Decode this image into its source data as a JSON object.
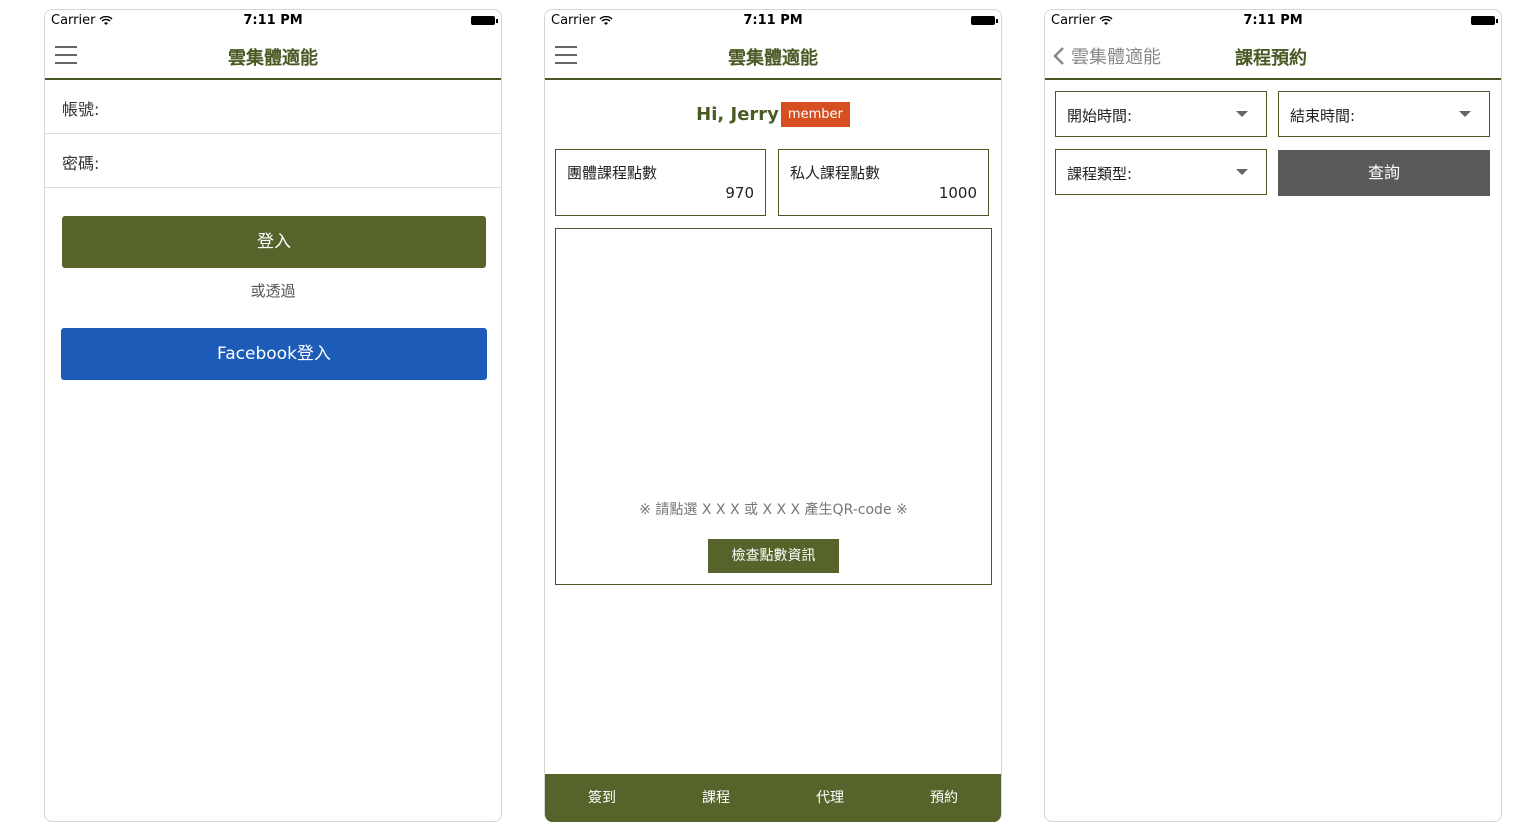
{
  "status_bar": {
    "carrier": "Carrier",
    "time": "7:11 PM"
  },
  "login": {
    "title": "雲集體適能",
    "account_label": "帳號:",
    "password_label": "密碼:",
    "login_button": "登入",
    "or_text": "或透過",
    "facebook_button": "Facebook登入"
  },
  "home": {
    "title": "雲集體適能",
    "greeting": "Hi, Jerry",
    "badge": "member",
    "group_points_label": "團體課程點數",
    "group_points_value": "970",
    "private_points_label": "私人課程點數",
    "private_points_value": "1000",
    "qr_hint": "※ 請點選 X X X 或 X X X 產生QR-code ※",
    "check_button": "檢查點數資訊",
    "tabs": [
      "簽到",
      "課程",
      "代理",
      "預約"
    ]
  },
  "booking": {
    "back_label": "雲集體適能",
    "title": "課程預約",
    "start_time_label": "開始時間:",
    "end_time_label": "結束時間:",
    "course_type_label": "課程類型:",
    "query_button": "查詢"
  },
  "colors": {
    "olive": "#56642b",
    "facebook": "#1c5bb8",
    "badge": "#d54f20",
    "query": "#5a5a5a"
  }
}
